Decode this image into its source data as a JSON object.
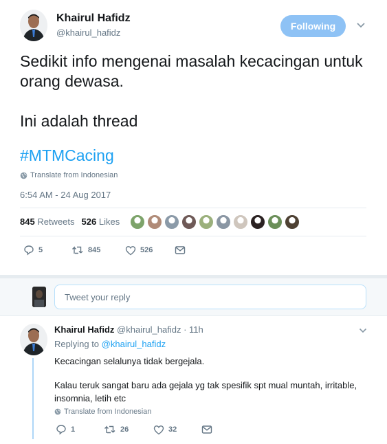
{
  "main_tweet": {
    "author_name": "Khairul Hafidz",
    "author_handle": "@khairul_hafidz",
    "follow_label": "Following",
    "text_lines": [
      "Sedikit info mengenai masalah kecacingan untuk orang dewasa.",
      "Ini adalah thread"
    ],
    "hashtag": "#MTMCacing",
    "translate_label": "Translate from Indonesian",
    "timestamp": "6:54 AM - 24 Aug 2017",
    "retweets_count": "845",
    "retweets_label": "Retweets",
    "likes_count": "526",
    "likes_label": "Likes",
    "liker_colors": [
      "#7da36a",
      "#b08b78",
      "#8b9aa8",
      "#6f5a57",
      "#9bb07c",
      "#8a96a3",
      "#cfc6bd",
      "#2b2222",
      "#6b8f59",
      "#4e4133"
    ],
    "actions": {
      "reply_count": "5",
      "retweet_count": "845",
      "like_count": "526"
    }
  },
  "reply_box": {
    "placeholder": "Tweet your reply"
  },
  "reply_tweet": {
    "author_name": "Khairul Hafidz",
    "author_handle": "@khairul_hafidz",
    "separator": "·",
    "time": "11h",
    "replying_prefix": "Replying to",
    "replying_handle": "@khairul_hafidz",
    "paragraph_1": "Kecacingan selalunya tidak bergejala.",
    "paragraph_2": "Kalau teruk sangat baru ada gejala yg tak spesifik spt mual muntah, irritable, insomnia, letih etc",
    "translate_label": "Translate from Indonesian",
    "actions": {
      "reply_count": "1",
      "retweet_count": "26",
      "like_count": "32"
    }
  },
  "colors": {
    "accent": "#1da1f2",
    "follow_button": "#8ec2f5",
    "muted_text": "#657786",
    "divider": "#e6ecf0",
    "thread_line": "#aed6f7"
  }
}
